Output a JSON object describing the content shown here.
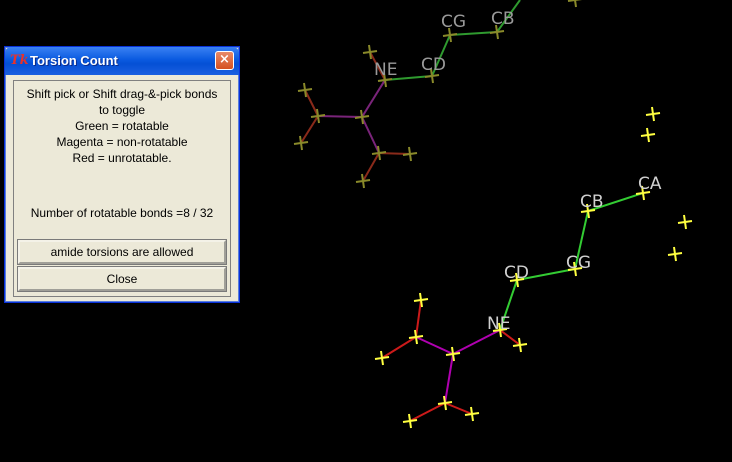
{
  "dialog": {
    "title": "Torsion Count",
    "icon_label": "Tk",
    "close_glyph": "×",
    "instructions": [
      "Shift pick or Shift drag-&-pick bonds",
      "to toggle",
      "Green = rotatable",
      "Magenta = non-rotatable",
      "Red = unrotatable."
    ],
    "count_text": "Number of rotatable bonds =8 / 32",
    "amide_button": "amide torsions are allowed",
    "close_button": "Close"
  },
  "molecule": {
    "colors": {
      "rotatable": "#33cc33",
      "non_rotatable": "#b000b0",
      "unrotatable": "#cc1a1a",
      "hydrogen": "#ffff40",
      "dim_rotatable": "#2f9a2f",
      "dim_non_rotatable": "#7a247a",
      "dim_unrotatable": "#8a2a1a",
      "dim_hydrogen": "#8a8a2a",
      "label": "#d0d0d0",
      "dim_label": "#9a9a9a"
    },
    "labels": {
      "ne_top": "NE",
      "cd_top": "CD",
      "cg_top": "CG",
      "cb_top": "CB",
      "ca_main": "CA",
      "cb_main": "CB",
      "cg_main": "CG",
      "cd_main": "CD",
      "ne_main": "NE"
    }
  }
}
